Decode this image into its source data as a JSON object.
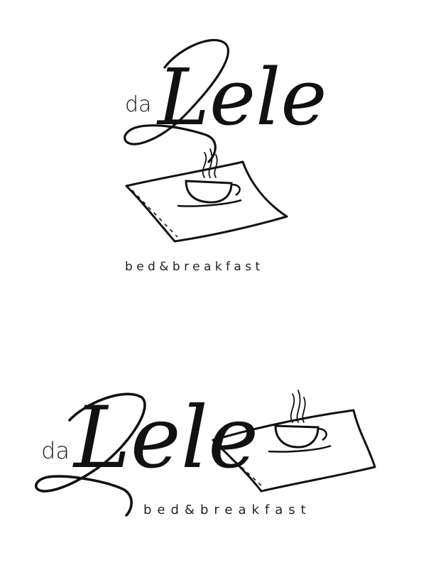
{
  "brand": {
    "prefix": "da",
    "name": "Lele",
    "tagline": "bed&breakfast"
  },
  "colors": {
    "ink": "#111111",
    "background": "#ffffff"
  },
  "icons": [
    "pillow-icon",
    "steaming-cup-icon"
  ]
}
